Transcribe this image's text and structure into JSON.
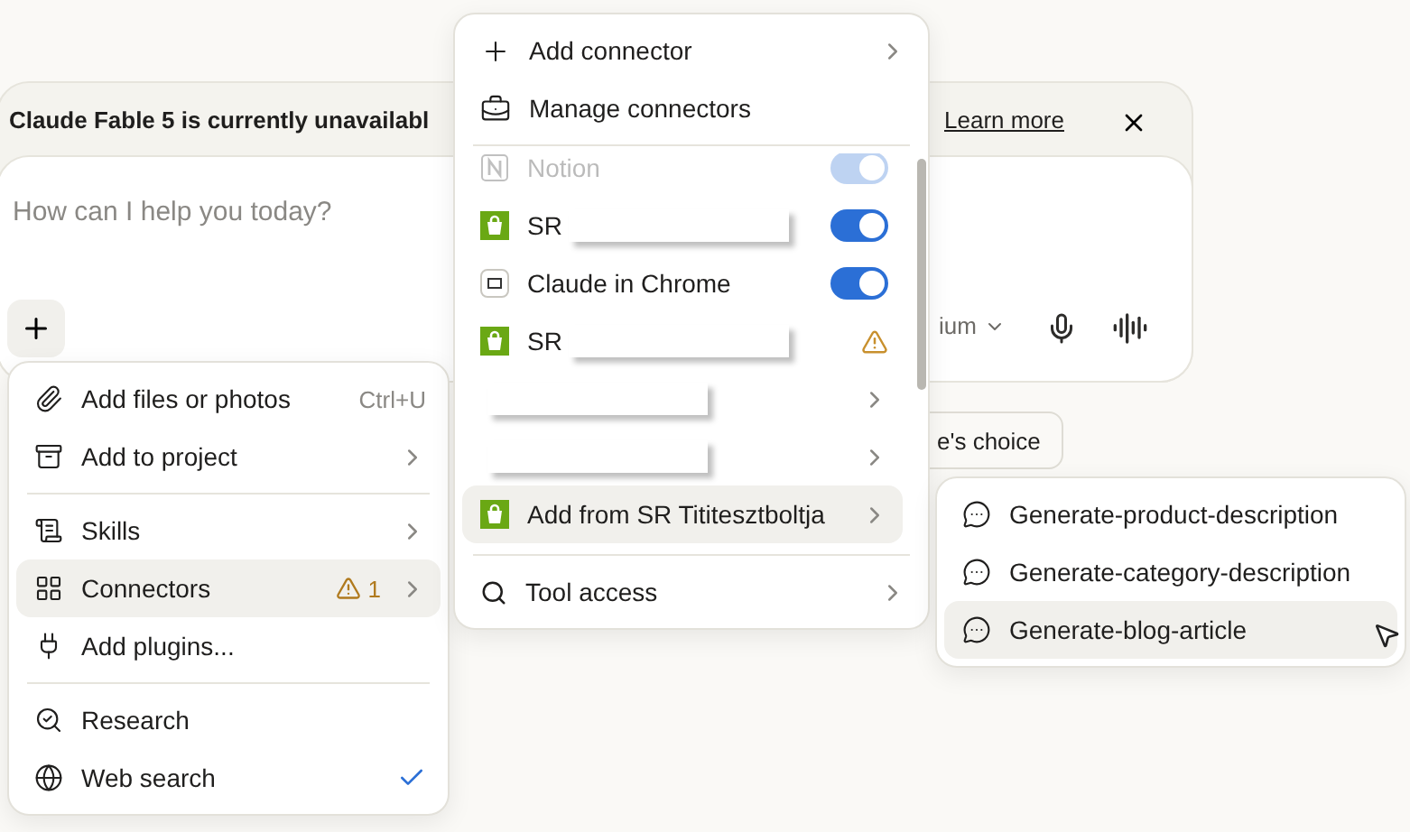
{
  "banner": {
    "text": "Claude Fable 5 is currently unavailabl",
    "link": "Learn more"
  },
  "composer": {
    "placeholder": "How can I help you today?",
    "model": "ium"
  },
  "chip": {
    "label": "e's choice"
  },
  "attach_menu": {
    "groups": [
      [
        {
          "label": "Add files or photos",
          "shortcut": "Ctrl+U",
          "submenu": false,
          "selected": false
        },
        {
          "label": "Add to project",
          "submenu": true,
          "selected": false
        }
      ],
      [
        {
          "label": "Skills",
          "submenu": true,
          "selected": false
        },
        {
          "label": "Connectors",
          "warning": "1",
          "submenu": true,
          "selected": true
        },
        {
          "label": "Add plugins...",
          "submenu": false,
          "selected": false
        }
      ],
      [
        {
          "label": "Research",
          "submenu": false,
          "selected": false,
          "checked": false
        },
        {
          "label": "Web search",
          "submenu": false,
          "selected": false,
          "checked": true
        }
      ]
    ]
  },
  "connector_menu": {
    "top": [
      {
        "label": "Add connector",
        "submenu": true
      },
      {
        "label": "Manage connectors",
        "submenu": false
      }
    ],
    "items": [
      {
        "kind": "toggle",
        "label": "Notion",
        "on": true,
        "disabled": true,
        "redacted": false,
        "selected": false
      },
      {
        "kind": "toggle",
        "label": "SR",
        "on": true,
        "disabled": false,
        "redacted": true,
        "selected": false
      },
      {
        "kind": "toggle",
        "label": "Claude in Chrome",
        "on": true,
        "disabled": false,
        "redacted": false,
        "selected": false
      },
      {
        "kind": "warning",
        "label": "SR",
        "disabled": false,
        "redacted": true,
        "selected": false
      },
      {
        "kind": "submenu",
        "disabled": false,
        "redacted": true,
        "selected": false
      },
      {
        "kind": "submenu",
        "disabled": false,
        "redacted": true,
        "selected": false
      },
      {
        "kind": "submenu",
        "label": "Add from SR Tititesztboltja",
        "disabled": false,
        "redacted": false,
        "selected": true
      }
    ],
    "bottom": [
      {
        "label": "Tool access",
        "submenu": true
      }
    ]
  },
  "skills_menu": {
    "items": [
      {
        "label": "Generate-product-description",
        "selected": false
      },
      {
        "label": "Generate-category-description",
        "selected": false
      },
      {
        "label": "Generate-blog-article",
        "selected": true
      }
    ]
  }
}
